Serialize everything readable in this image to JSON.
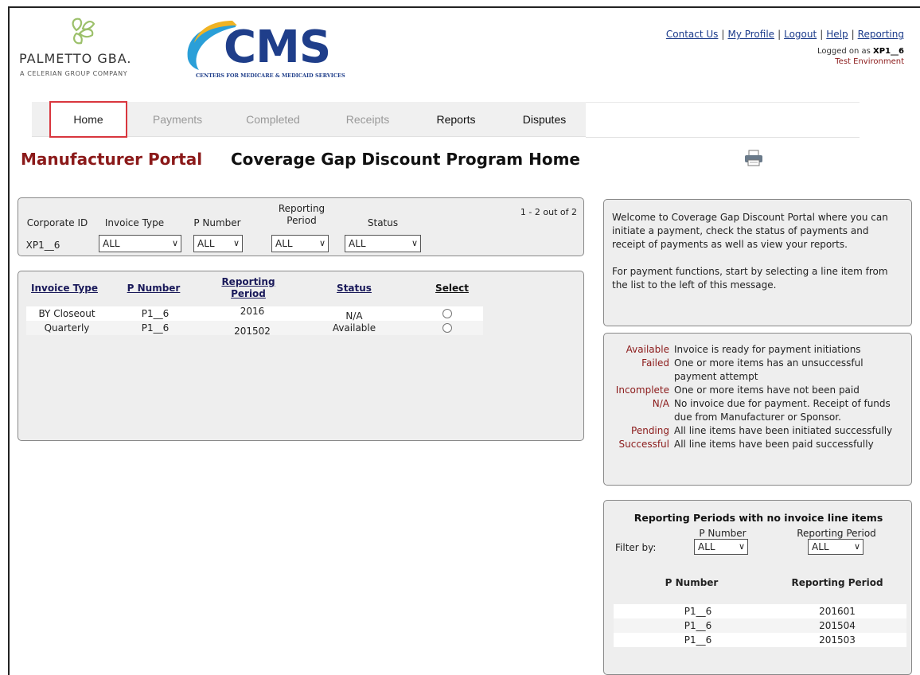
{
  "branding": {
    "pgba_name": "PALMETTO GBA.",
    "pgba_tagline": "A CELERIAN GROUP COMPANY",
    "cms_logo": "CMS",
    "cms_tagline": "CENTERS FOR MEDICARE & MEDICAID SERVICES"
  },
  "top_links": [
    "Contact Us",
    "My Profile",
    "Logout",
    "Help",
    "Reporting"
  ],
  "session": {
    "logged_prefix": "Logged on as ",
    "user": "XP1__6",
    "environment": "Test Environment"
  },
  "nav": {
    "items": [
      {
        "label": "Home",
        "state": "active"
      },
      {
        "label": "Payments",
        "state": "disabled"
      },
      {
        "label": "Completed",
        "state": "disabled"
      },
      {
        "label": "Receipts",
        "state": "disabled"
      },
      {
        "label": "Reports",
        "state": "enabled"
      },
      {
        "label": "Disputes",
        "state": "enabled"
      }
    ]
  },
  "titles": {
    "portal": "Manufacturer Portal",
    "page": "Coverage Gap Discount Program Home"
  },
  "filters": {
    "corporate_id_label": "Corporate ID",
    "corporate_id_value": "XP1__6",
    "invoice_type_label": "Invoice Type",
    "invoice_type_value": "ALL",
    "p_number_label": "P Number",
    "p_number_value": "ALL",
    "reporting_period_label_1": "Reporting",
    "reporting_period_label_2": "Period",
    "reporting_period_value": "ALL",
    "status_label": "Status",
    "status_value": "ALL",
    "pager": "1 - 2 out of 2"
  },
  "invoice_table": {
    "headers": {
      "invoice_type": "Invoice Type",
      "p_number": "P Number",
      "reporting_period_1": "Reporting",
      "reporting_period_2": "Period",
      "status": "Status",
      "select": "Select"
    },
    "rows": [
      {
        "invoice_type": "BY Closeout",
        "p_number": "P1__6",
        "reporting_period": "2016",
        "status": "N/A"
      },
      {
        "invoice_type": "Quarterly",
        "p_number": "P1__6",
        "reporting_period": "201502",
        "status": "Available"
      }
    ]
  },
  "welcome": {
    "paragraph_1": "Welcome to Coverage Gap Discount Portal where you can initiate a payment, check the status of payments and receipt of payments as well as view your reports.",
    "paragraph_2": "For payment functions, start by selecting a line item from the list to the left of this message."
  },
  "status_legend": [
    {
      "term": "Available",
      "description": "Invoice is ready for payment initiations"
    },
    {
      "term": "Failed",
      "description": "One or more items has an unsuccessful payment attempt"
    },
    {
      "term": "Incomplete",
      "description": "One or more items have not been paid"
    },
    {
      "term": "N/A",
      "description": "No invoice due for payment. Receipt of funds due from Manufacturer or Sponsor."
    },
    {
      "term": "Pending",
      "description": "All line items have been initiated successfully"
    },
    {
      "term": "Successful",
      "description": "All line items have been paid successfully"
    }
  ],
  "no_invoice": {
    "title": "Reporting Periods with no invoice line items",
    "filter_by": "Filter by:",
    "p_number_label": "P Number",
    "p_number_value": "ALL",
    "reporting_period_label": "Reporting Period",
    "reporting_period_value": "ALL",
    "col_p_number": "P Number",
    "col_reporting_period": "Reporting Period",
    "rows": [
      {
        "p_number": "P1__6",
        "reporting_period": "201601"
      },
      {
        "p_number": "P1__6",
        "reporting_period": "201504"
      },
      {
        "p_number": "P1__6",
        "reporting_period": "201503"
      }
    ]
  },
  "colors": {
    "brand_dark_red": "#8b1a1a",
    "cms_blue": "#1f3e8a",
    "active_tab_border": "#d9363e",
    "link": "#1a3a8a"
  },
  "icons": [
    "palmetto-leaf-logo-icon",
    "cms-swoosh-logo-icon",
    "printer-icon",
    "chevron-down-icon",
    "radio-icon"
  ]
}
